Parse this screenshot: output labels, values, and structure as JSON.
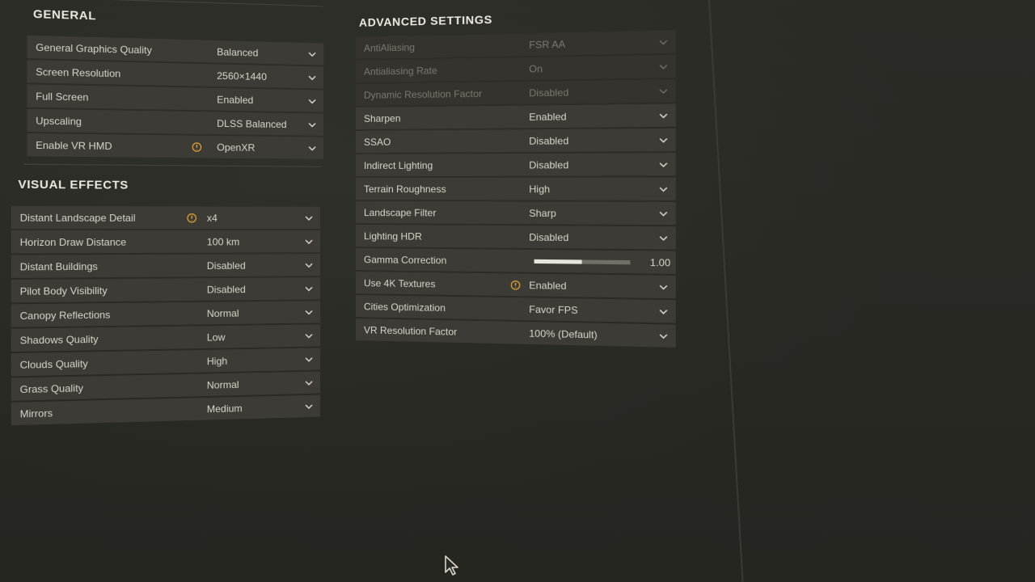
{
  "general": {
    "title": "GENERAL",
    "rows": [
      {
        "label": "General Graphics Quality",
        "value": "Balanced"
      },
      {
        "label": "Screen Resolution",
        "value": "2560×1440"
      },
      {
        "label": "Full Screen",
        "value": "Enabled"
      },
      {
        "label": "Upscaling",
        "value": "DLSS Balanced"
      },
      {
        "label": "Enable VR HMD",
        "value": "OpenXR",
        "warning": true
      }
    ]
  },
  "visual_effects": {
    "title": "VISUAL EFFECTS",
    "rows": [
      {
        "label": "Distant Landscape Detail",
        "value": "x4",
        "warning": true
      },
      {
        "label": "Horizon Draw Distance",
        "value": "100 km"
      },
      {
        "label": "Distant Buildings",
        "value": "Disabled"
      },
      {
        "label": "Pilot Body Visibility",
        "value": "Disabled"
      },
      {
        "label": "Canopy Reflections",
        "value": "Normal"
      },
      {
        "label": "Shadows Quality",
        "value": "Low"
      },
      {
        "label": "Clouds Quality",
        "value": "High"
      },
      {
        "label": "Grass Quality",
        "value": "Normal"
      },
      {
        "label": "Mirrors",
        "value": "Medium"
      }
    ]
  },
  "advanced": {
    "title": "ADVANCED SETTINGS",
    "rows": [
      {
        "label": "AntiAliasing",
        "value": "FSR AA",
        "disabled": true
      },
      {
        "label": "Antialiasing Rate",
        "value": "On",
        "disabled": true
      },
      {
        "label": "Dynamic Resolution Factor",
        "value": "Disabled",
        "disabled": true
      },
      {
        "label": "Sharpen",
        "value": "Enabled"
      },
      {
        "label": "SSAO",
        "value": "Disabled"
      },
      {
        "label": "Indirect Lighting",
        "value": "Disabled"
      },
      {
        "label": "Terrain Roughness",
        "value": "High"
      },
      {
        "label": "Landscape Filter",
        "value": "Sharp"
      },
      {
        "label": "Lighting HDR",
        "value": "Disabled"
      },
      {
        "label": "Gamma Correction",
        "value": "1.00",
        "slider": true,
        "slider_fraction": 0.5
      },
      {
        "label": "Use 4K Textures",
        "value": "Enabled",
        "warning": true
      },
      {
        "label": "Cities Optimization",
        "value": "Favor FPS"
      },
      {
        "label": "VR Resolution Factor",
        "value": "100% (Default)"
      }
    ]
  },
  "colors": {
    "warning": "#e0a23a",
    "row_bg": "#3c3b35",
    "text": "#d8d6cc",
    "disabled_text": "#7a7970"
  },
  "icons": {
    "chevron": "chevron-down-icon",
    "warning": "warning-circle-icon",
    "cursor": "mouse-pointer-icon"
  }
}
